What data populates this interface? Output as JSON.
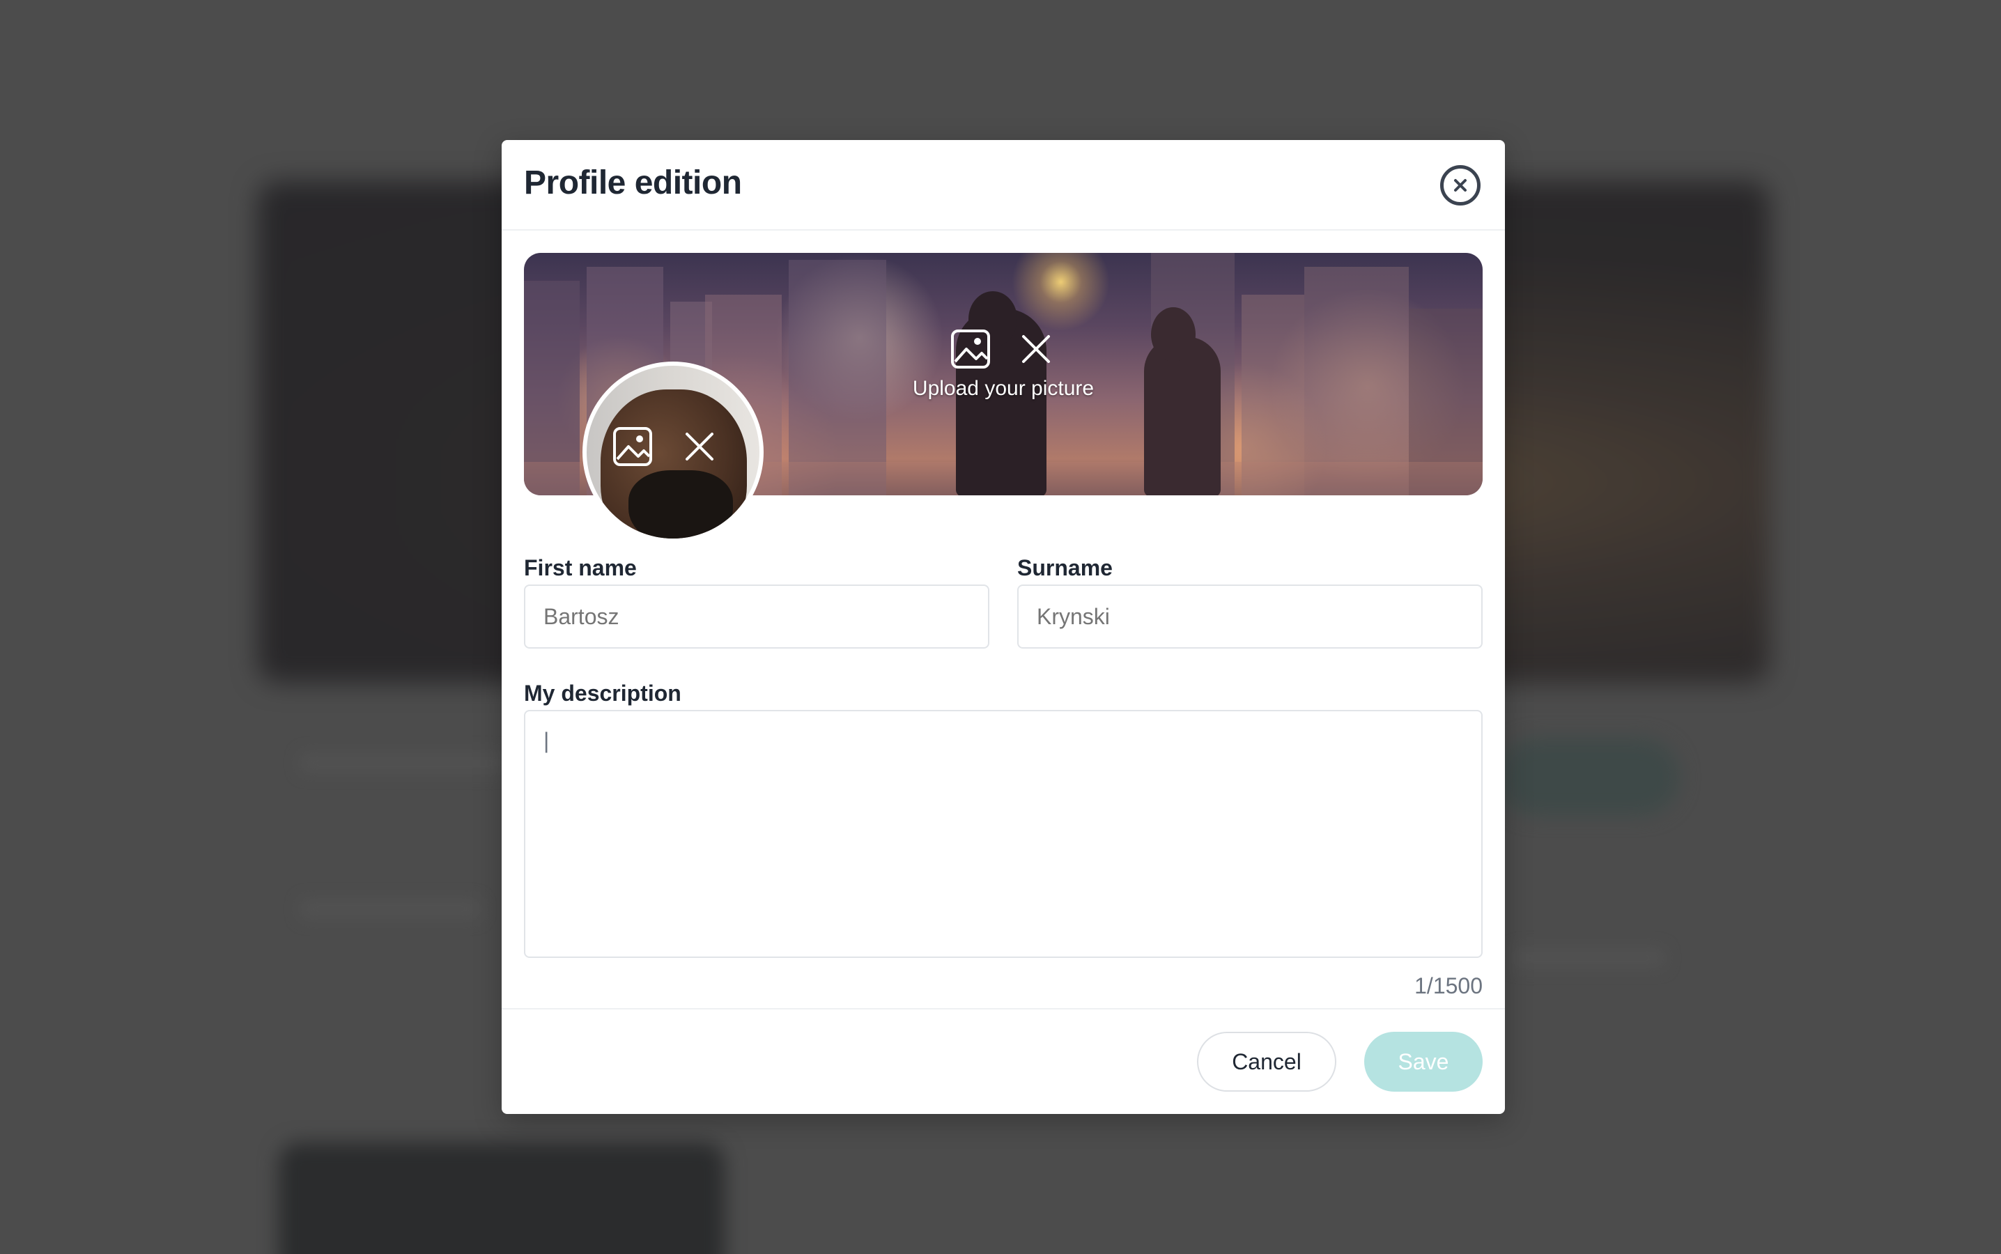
{
  "modal": {
    "title": "Profile edition",
    "close_icon": "close-circle-icon"
  },
  "banner": {
    "upload_caption": "Upload your picture",
    "upload_icon": "image-icon",
    "remove_icon": "close-icon"
  },
  "avatar": {
    "upload_icon": "image-icon",
    "remove_icon": "close-icon"
  },
  "form": {
    "first_name": {
      "label": "First name",
      "placeholder": "Bartosz"
    },
    "surname": {
      "label": "Surname",
      "placeholder": "Krynski"
    },
    "description": {
      "label": "My description",
      "value": "|",
      "counter": "1/1500"
    }
  },
  "footer": {
    "cancel_label": "Cancel",
    "save_label": "Save"
  },
  "colors": {
    "accent_disabled": "#b5e3e1",
    "text_dark": "#1f2733",
    "text_muted": "#6c7480"
  }
}
